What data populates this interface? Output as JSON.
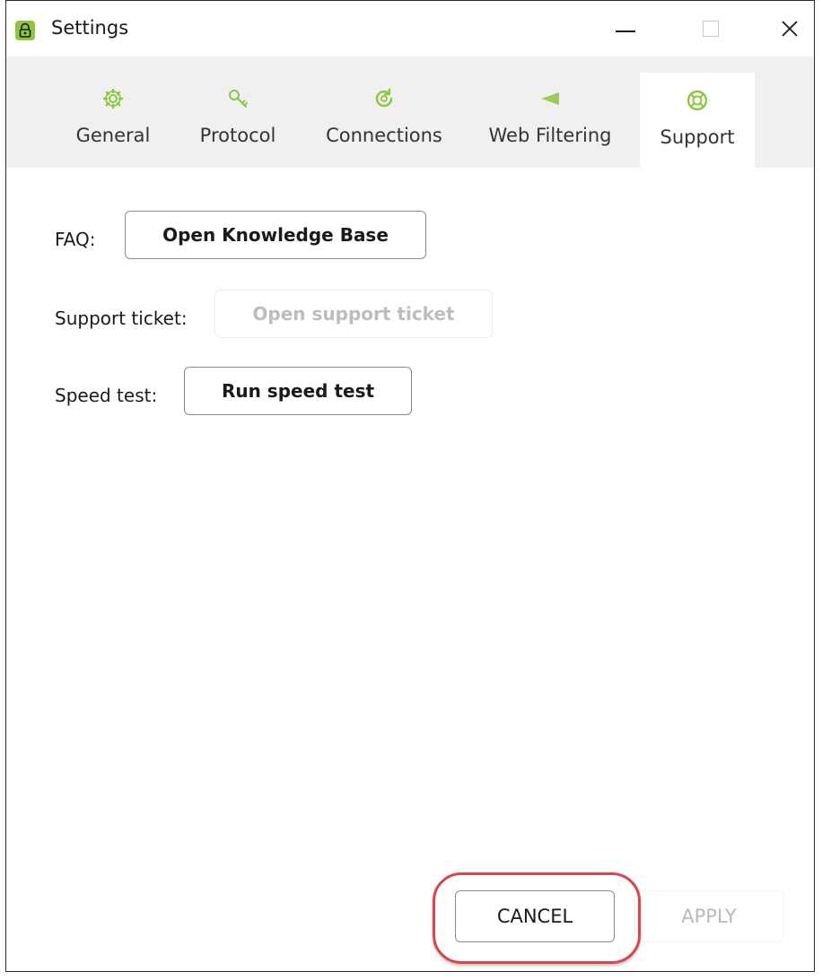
{
  "window": {
    "title": "Settings",
    "title_icon": "lock-icon"
  },
  "window_controls": {
    "minimize_icon": "minimize-icon",
    "maximize_icon": "maximize-icon",
    "close_glyph": "✕"
  },
  "tabs": [
    {
      "label": "General",
      "icon": "gear-icon",
      "active": false
    },
    {
      "label": "Protocol",
      "icon": "key-icon",
      "active": false
    },
    {
      "label": "Connections",
      "icon": "refresh-icon",
      "active": false
    },
    {
      "label": "Web Filtering",
      "icon": "filter-icon",
      "active": false
    },
    {
      "label": "Support",
      "icon": "lifebuoy-icon",
      "active": true
    }
  ],
  "support": {
    "faq_label": "FAQ:",
    "faq_button": "Open Knowledge Base",
    "ticket_label": "Support ticket:",
    "ticket_button": "Open support ticket",
    "speed_label": "Speed test:",
    "speed_button": "Run speed test"
  },
  "footer": {
    "cancel_label": "CANCEL",
    "apply_label": "APPLY"
  },
  "colors": {
    "accent_green": "#8dc63f",
    "highlight_red": "#d9444e",
    "tab_strip_bg": "#f0f0f0"
  }
}
